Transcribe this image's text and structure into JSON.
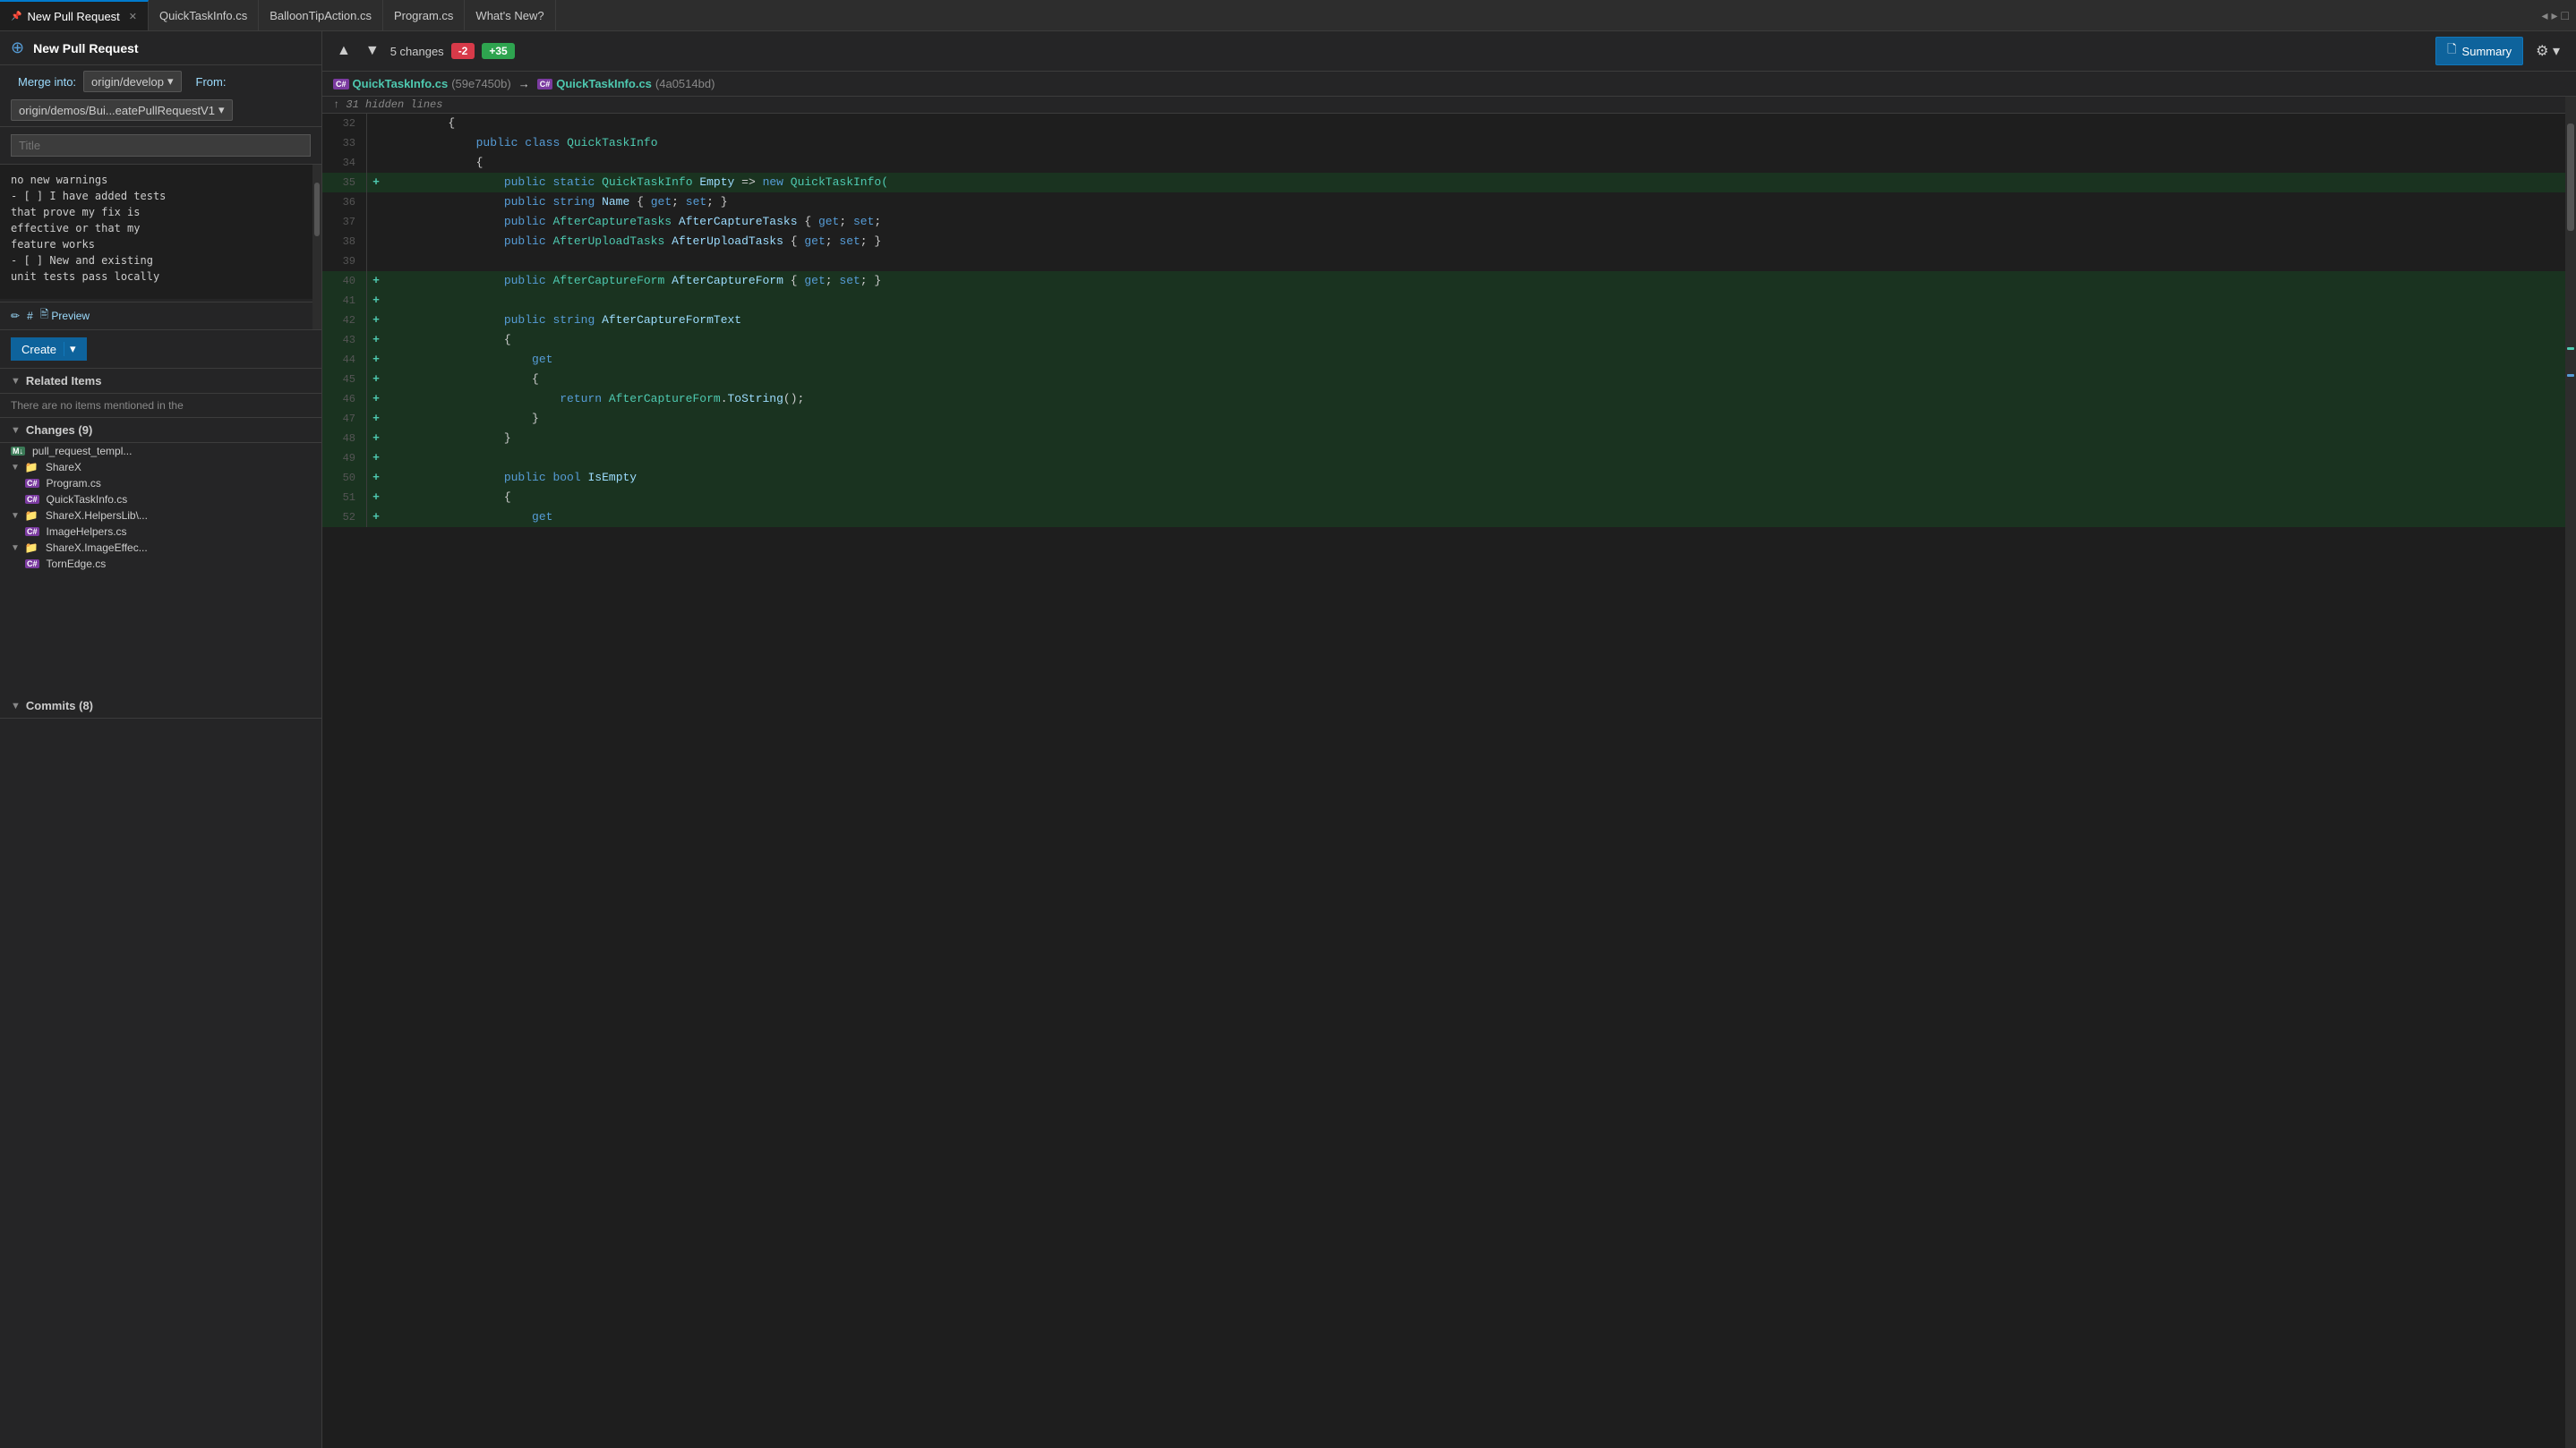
{
  "tabs": [
    {
      "id": "new-pr",
      "label": "New Pull Request",
      "active": true,
      "pinned": true,
      "closeable": true
    },
    {
      "id": "quicktaskinfo",
      "label": "QuickTaskInfo.cs",
      "active": false,
      "pinned": false,
      "closeable": false
    },
    {
      "id": "balloontipaction",
      "label": "BalloonTipAction.cs",
      "active": false,
      "pinned": false,
      "closeable": false
    },
    {
      "id": "program",
      "label": "Program.cs",
      "active": false,
      "pinned": false,
      "closeable": false
    },
    {
      "id": "whatsnew",
      "label": "What's New?",
      "active": false,
      "pinned": false,
      "closeable": false
    }
  ],
  "pr": {
    "icon": "⊕",
    "title_label": "New Pull Request",
    "merge_into_label": "Merge into:",
    "merge_into_value": "origin/develop",
    "from_label": "From:",
    "from_value": "origin/demos/Bui...eatePullRequestV1",
    "title_placeholder": "Title",
    "description": "no new warnings\n- [ ] I have added tests\nthat prove my fix is\neffective or that my\nfeature works\n- [ ] New and existing\nunit tests pass locally"
  },
  "toolbar": {
    "up_label": "▲",
    "down_label": "▼",
    "changes_label": "5 changes",
    "deletions": "-2",
    "additions": "+35",
    "summary_label": "Summary",
    "settings_label": "⚙"
  },
  "file_header": {
    "left_cs": "C#",
    "left_name": "QuickTaskInfo.cs",
    "left_hash": "(59e7450b)",
    "arrow": "→",
    "right_cs": "C#",
    "right_name": "QuickTaskInfo.cs",
    "right_hash": "(4a0514bd)"
  },
  "diff": {
    "hidden_hint": "↑ 31 hidden lines",
    "lines": [
      {
        "num": "32",
        "prefix": " ",
        "code": "        {",
        "added": false,
        "tokens": [
          {
            "text": "        {",
            "cls": "punct"
          }
        ]
      },
      {
        "num": "33",
        "prefix": " ",
        "code": "            public class QuickTaskInfo",
        "added": false,
        "tokens": [
          {
            "text": "            ",
            "cls": ""
          },
          {
            "text": "public",
            "cls": "kw"
          },
          {
            "text": " ",
            "cls": ""
          },
          {
            "text": "class",
            "cls": "kw"
          },
          {
            "text": " ",
            "cls": ""
          },
          {
            "text": "QuickTaskInfo",
            "cls": "type"
          }
        ]
      },
      {
        "num": "34",
        "prefix": " ",
        "code": "            {",
        "added": false,
        "tokens": [
          {
            "text": "            {",
            "cls": "punct"
          }
        ]
      },
      {
        "num": "35",
        "prefix": "+",
        "code": "                public static QuickTaskInfo Empty => new QuickTaskInfo(",
        "added": true,
        "tokens": [
          {
            "text": "                ",
            "cls": ""
          },
          {
            "text": "public",
            "cls": "kw"
          },
          {
            "text": " ",
            "cls": ""
          },
          {
            "text": "static",
            "cls": "kw"
          },
          {
            "text": " ",
            "cls": ""
          },
          {
            "text": "QuickTaskInfo",
            "cls": "type"
          },
          {
            "text": " ",
            "cls": ""
          },
          {
            "text": "Empty",
            "cls": "prop"
          },
          {
            "text": " => ",
            "cls": "op"
          },
          {
            "text": "new",
            "cls": "kw"
          },
          {
            "text": " ",
            "cls": ""
          },
          {
            "text": "QuickTaskInfo(",
            "cls": "type"
          }
        ]
      },
      {
        "num": "36",
        "prefix": " ",
        "code": "                public string Name { get; set; }",
        "added": false,
        "tokens": [
          {
            "text": "                ",
            "cls": ""
          },
          {
            "text": "public",
            "cls": "kw"
          },
          {
            "text": " ",
            "cls": ""
          },
          {
            "text": "string",
            "cls": "kw"
          },
          {
            "text": " ",
            "cls": ""
          },
          {
            "text": "Name",
            "cls": "prop"
          },
          {
            "text": " { ",
            "cls": "punct"
          },
          {
            "text": "get",
            "cls": "kw"
          },
          {
            "text": "; ",
            "cls": "punct"
          },
          {
            "text": "set",
            "cls": "kw"
          },
          {
            "text": "; }",
            "cls": "punct"
          }
        ]
      },
      {
        "num": "37",
        "prefix": " ",
        "code": "                public AfterCaptureTasks AfterCaptureTasks { get; set;",
        "added": false,
        "tokens": [
          {
            "text": "                ",
            "cls": ""
          },
          {
            "text": "public",
            "cls": "kw"
          },
          {
            "text": " ",
            "cls": ""
          },
          {
            "text": "AfterCaptureTasks",
            "cls": "type"
          },
          {
            "text": " ",
            "cls": ""
          },
          {
            "text": "AfterCaptureTasks",
            "cls": "prop"
          },
          {
            "text": " { ",
            "cls": "punct"
          },
          {
            "text": "get",
            "cls": "kw"
          },
          {
            "text": "; ",
            "cls": "punct"
          },
          {
            "text": "set",
            "cls": "kw"
          },
          {
            "text": ";",
            "cls": "punct"
          }
        ]
      },
      {
        "num": "38",
        "prefix": " ",
        "code": "                public AfterUploadTasks AfterUploadTasks { get; set; }",
        "added": false,
        "tokens": [
          {
            "text": "                ",
            "cls": ""
          },
          {
            "text": "public",
            "cls": "kw"
          },
          {
            "text": " ",
            "cls": ""
          },
          {
            "text": "AfterUploadTasks",
            "cls": "type"
          },
          {
            "text": " ",
            "cls": ""
          },
          {
            "text": "AfterUploadTasks",
            "cls": "prop"
          },
          {
            "text": " { ",
            "cls": "punct"
          },
          {
            "text": "get",
            "cls": "kw"
          },
          {
            "text": "; ",
            "cls": "punct"
          },
          {
            "text": "set",
            "cls": "kw"
          },
          {
            "text": "; }",
            "cls": "punct"
          }
        ]
      },
      {
        "num": "39",
        "prefix": " ",
        "code": "",
        "added": false,
        "tokens": []
      },
      {
        "num": "40",
        "prefix": "+",
        "code": "                public AfterCaptureForm AfterCaptureForm { get; set; }",
        "added": true,
        "tokens": [
          {
            "text": "                ",
            "cls": ""
          },
          {
            "text": "public",
            "cls": "kw"
          },
          {
            "text": " ",
            "cls": ""
          },
          {
            "text": "AfterCaptureForm",
            "cls": "type"
          },
          {
            "text": " ",
            "cls": ""
          },
          {
            "text": "AfterCaptureForm",
            "cls": "prop"
          },
          {
            "text": " { ",
            "cls": "punct"
          },
          {
            "text": "get",
            "cls": "kw"
          },
          {
            "text": "; ",
            "cls": "punct"
          },
          {
            "text": "set",
            "cls": "kw"
          },
          {
            "text": "; }",
            "cls": "punct"
          }
        ]
      },
      {
        "num": "41",
        "prefix": "+",
        "code": "",
        "added": true,
        "tokens": []
      },
      {
        "num": "42",
        "prefix": "+",
        "code": "                public string AfterCaptureFormText",
        "added": true,
        "tokens": [
          {
            "text": "                ",
            "cls": ""
          },
          {
            "text": "public",
            "cls": "kw"
          },
          {
            "text": " ",
            "cls": ""
          },
          {
            "text": "string",
            "cls": "kw"
          },
          {
            "text": " ",
            "cls": ""
          },
          {
            "text": "AfterCaptureFormText",
            "cls": "prop"
          }
        ]
      },
      {
        "num": "43",
        "prefix": "+",
        "code": "                {",
        "added": true,
        "tokens": [
          {
            "text": "                {",
            "cls": "punct"
          }
        ]
      },
      {
        "num": "44",
        "prefix": "+",
        "code": "                    get",
        "added": true,
        "tokens": [
          {
            "text": "                    ",
            "cls": ""
          },
          {
            "text": "get",
            "cls": "kw"
          }
        ]
      },
      {
        "num": "45",
        "prefix": "+",
        "code": "                    {",
        "added": true,
        "tokens": [
          {
            "text": "                    {",
            "cls": "punct"
          }
        ]
      },
      {
        "num": "46",
        "prefix": "+",
        "code": "                        return AfterCaptureForm.ToString();",
        "added": true,
        "tokens": [
          {
            "text": "                        ",
            "cls": ""
          },
          {
            "text": "return",
            "cls": "kw"
          },
          {
            "text": " ",
            "cls": ""
          },
          {
            "text": "AfterCaptureForm",
            "cls": "type"
          },
          {
            "text": ".",
            "cls": "punct"
          },
          {
            "text": "ToString",
            "cls": "prop"
          },
          {
            "text": "();",
            "cls": "punct"
          }
        ]
      },
      {
        "num": "47",
        "prefix": "+",
        "code": "                    }",
        "added": true,
        "tokens": [
          {
            "text": "                    }",
            "cls": "punct"
          }
        ]
      },
      {
        "num": "48",
        "prefix": "+",
        "code": "                }",
        "added": true,
        "tokens": [
          {
            "text": "                }",
            "cls": "punct"
          }
        ]
      },
      {
        "num": "49",
        "prefix": "+",
        "code": "",
        "added": true,
        "tokens": []
      },
      {
        "num": "50",
        "prefix": "+",
        "code": "                public bool IsEmpty",
        "added": true,
        "tokens": [
          {
            "text": "                ",
            "cls": ""
          },
          {
            "text": "public",
            "cls": "kw"
          },
          {
            "text": " ",
            "cls": ""
          },
          {
            "text": "bool",
            "cls": "kw"
          },
          {
            "text": " ",
            "cls": ""
          },
          {
            "text": "IsEmpty",
            "cls": "prop"
          }
        ]
      },
      {
        "num": "51",
        "prefix": "+",
        "code": "                {",
        "added": true,
        "tokens": [
          {
            "text": "                {",
            "cls": "punct"
          }
        ]
      },
      {
        "num": "52",
        "prefix": "+",
        "code": "                    get",
        "added": true,
        "tokens": [
          {
            "text": "                    ",
            "cls": ""
          },
          {
            "text": "get",
            "cls": "kw"
          }
        ]
      }
    ]
  },
  "related_items": {
    "header": "Related Items",
    "content": "There are no items mentioned in the"
  },
  "changes": {
    "header": "Changes (9)",
    "items": [
      {
        "type": "md",
        "label": "pull_request_templ...",
        "depth": 0
      },
      {
        "type": "folder",
        "label": "ShareX",
        "depth": 0,
        "expanded": true
      },
      {
        "type": "cs",
        "label": "Program.cs",
        "depth": 1
      },
      {
        "type": "cs",
        "label": "QuickTaskInfo.cs",
        "depth": 1
      },
      {
        "type": "folder",
        "label": "ShareX.HelpersLib\\...",
        "depth": 0,
        "expanded": true
      },
      {
        "type": "cs",
        "label": "ImageHelpers.cs",
        "depth": 1
      },
      {
        "type": "folder",
        "label": "ShareX.ImageEffec...",
        "depth": 0,
        "expanded": true
      },
      {
        "type": "cs",
        "label": "TornEdge.cs",
        "depth": 1
      }
    ]
  },
  "commits": {
    "header": "Commits (8)"
  },
  "desc_toolbar": {
    "edit_label": "✏",
    "hash_label": "#",
    "preview_label": "Preview"
  },
  "create_btn": {
    "label": "Create",
    "dropdown": "▾"
  }
}
